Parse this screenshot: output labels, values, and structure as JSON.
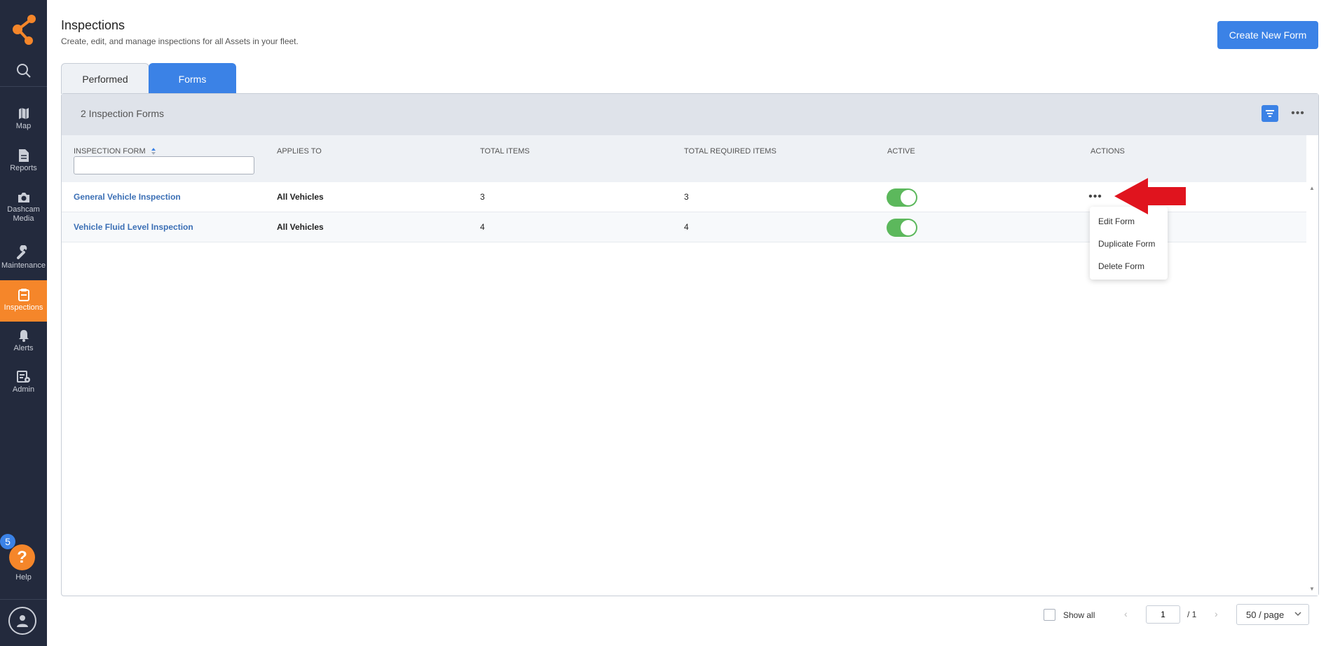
{
  "sidebar": {
    "items": [
      {
        "label": "Map",
        "icon": "map-icon"
      },
      {
        "label": "Reports",
        "icon": "reports-icon"
      },
      {
        "label": "Dashcam Media",
        "icon": "camera-icon"
      },
      {
        "label": "Maintenance",
        "icon": "wrench-icon"
      },
      {
        "label": "Inspections",
        "icon": "inspections-icon"
      },
      {
        "label": "Alerts",
        "icon": "bell-icon"
      },
      {
        "label": "Admin",
        "icon": "admin-icon"
      }
    ],
    "active": "Inspections",
    "help": {
      "badge": "5",
      "label": "Help"
    }
  },
  "header": {
    "title": "Inspections",
    "subtitle": "Create, edit, and manage inspections for all Assets in your fleet.",
    "create_button": "Create New Form"
  },
  "tabs": [
    {
      "label": "Performed",
      "active": false
    },
    {
      "label": "Forms",
      "active": true
    }
  ],
  "panel": {
    "count_label": "2 Inspection Forms"
  },
  "table": {
    "columns": [
      "INSPECTION FORM",
      "APPLIES TO",
      "TOTAL ITEMS",
      "TOTAL REQUIRED ITEMS",
      "ACTIVE",
      "ACTIONS"
    ],
    "rows": [
      {
        "form": "General Vehicle Inspection",
        "applies_to": "All Vehicles",
        "total_items": "3",
        "total_required": "3",
        "active": true
      },
      {
        "form": "Vehicle Fluid Level Inspection",
        "applies_to": "All Vehicles",
        "total_items": "4",
        "total_required": "4",
        "active": true
      }
    ]
  },
  "actions_menu": {
    "items": [
      "Edit Form",
      "Duplicate Form",
      "Delete Form"
    ]
  },
  "pagination": {
    "show_all_label": "Show all",
    "current_page": "1",
    "total_pages": "/ 1",
    "page_size": "50 / page"
  },
  "colors": {
    "sidebar_bg": "#232a3d",
    "accent_orange": "#f5862a",
    "primary_blue": "#3b82e6",
    "toggle_green": "#5cb85c",
    "annotation_red": "#e0141e"
  }
}
